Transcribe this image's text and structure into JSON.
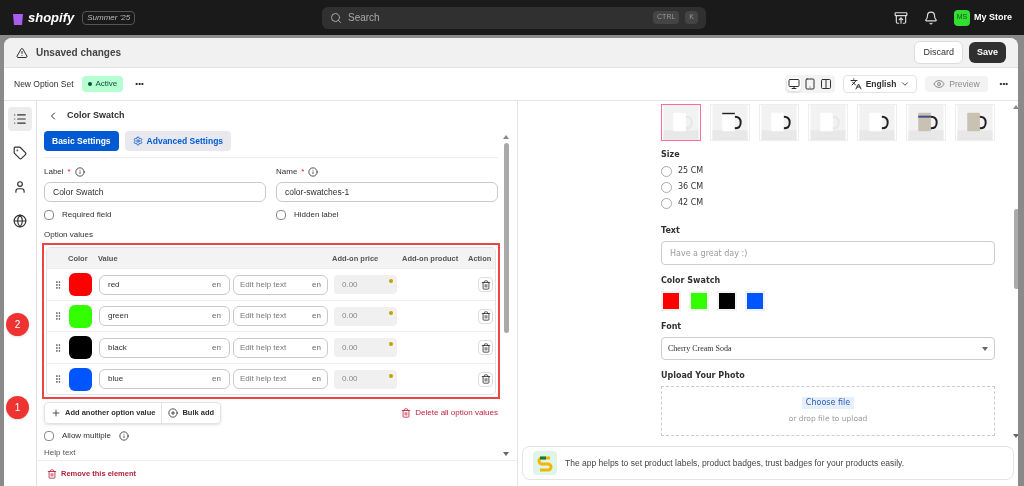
{
  "topbar": {
    "brand": "shopify",
    "edition": "Summer '25",
    "search": {
      "placeholder": "Search",
      "keys": [
        "CTRL",
        "K"
      ]
    },
    "avatar": "MS",
    "store": "My Store"
  },
  "save_bar": {
    "title": "Unsaved changes",
    "discard": "Discard",
    "save": "Save"
  },
  "header": {
    "title": "New Option Set",
    "status": "Active",
    "more": "•••",
    "language": "English",
    "preview": "Preview",
    "preview_disabled": true,
    "more_right": "•••"
  },
  "devices": [
    {
      "selected": true
    },
    {
      "selected": false
    },
    {
      "selected": false
    }
  ],
  "left_nav": [
    {
      "selected": true
    },
    {
      "selected": false
    },
    {
      "selected": false
    },
    {
      "selected": false
    }
  ],
  "editor": {
    "title": "Color Swatch",
    "tabs": [
      {
        "label": "Basic Settings",
        "selected": true
      },
      {
        "label": "Advanced Settings",
        "selected": false
      }
    ],
    "label_field": {
      "label": "Label",
      "required_mark": "*",
      "value": "Color Swatch"
    },
    "name_field": {
      "label": "Name",
      "required_mark": "*",
      "value": "color-swatches-1"
    },
    "required_field": {
      "label": "Required field",
      "checked": false
    },
    "hidden_label": {
      "label": "Hidden label",
      "checked": false
    },
    "option_values_title": "Option values",
    "columns": [
      "Color",
      "Value",
      "Add-on price",
      "Add-on product",
      "Action"
    ],
    "rows": [
      {
        "color": "#ff0000",
        "value": "red",
        "lang": "en",
        "help_placeholder": "Edit help text",
        "help_lang": "en",
        "price_placeholder": "0.00"
      },
      {
        "color": "#33ff00",
        "value": "green",
        "lang": "en",
        "help_placeholder": "Edit help text",
        "help_lang": "en",
        "price_placeholder": "0.00"
      },
      {
        "color": "#000000",
        "value": "black",
        "lang": "en",
        "help_placeholder": "Edit help text",
        "help_lang": "en",
        "price_placeholder": "0.00"
      },
      {
        "color": "#0055ff",
        "value": "blue",
        "lang": "en",
        "help_placeholder": "Edit help text",
        "help_lang": "en",
        "price_placeholder": "0.00"
      }
    ],
    "add_value": "Add another option value",
    "bulk_add": "Bulk add",
    "delete_all": "Delete all option values",
    "allow_multiple": {
      "label": "Allow multiple",
      "checked": false
    },
    "help_text": "Help text",
    "remove": "Remove this element"
  },
  "annotations": [
    "2",
    "1"
  ],
  "preview": {
    "images": [
      {
        "selected": true
      },
      {
        "selected": false
      },
      {
        "selected": false
      },
      {
        "selected": false
      },
      {
        "selected": false
      },
      {
        "selected": false
      },
      {
        "selected": false
      }
    ],
    "size_label": "Size",
    "sizes": [
      {
        "label": "25 CM",
        "selected": false
      },
      {
        "label": "36 CM",
        "selected": false
      },
      {
        "label": "42 CM",
        "selected": false
      }
    ],
    "text_label": "Text",
    "text_placeholder": "Have a great day :)",
    "swatch_label": "Color Swatch",
    "swatches": [
      {
        "color": "#ff0000"
      },
      {
        "color": "#33ff00"
      },
      {
        "color": "#000000"
      },
      {
        "color": "#0055ff"
      }
    ],
    "font_label": "Font",
    "font_value": "Cherry Cream Soda",
    "upload_label": "Upload Your Photo",
    "choose_file": "Choose file",
    "drop_hint": "or drop file to upload"
  },
  "banner": {
    "text": "The app helps to set product labels, product badges, trust badges for your products easily."
  }
}
